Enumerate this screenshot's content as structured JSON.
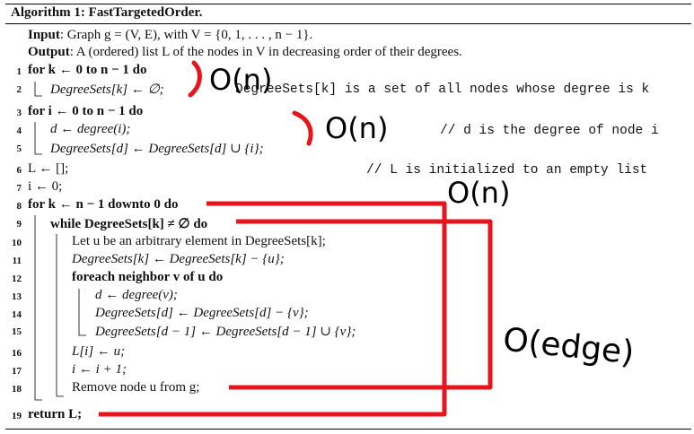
{
  "algorithm": {
    "title": "Algorithm 1: FastTargetedOrder.",
    "input_label": "Input",
    "input_text": ": Graph g = (V, E), with V = {0, 1, . . . , n − 1}.",
    "output_label": "Output",
    "output_text": ": A (ordered) list L of the nodes in V in decreasing order of their degrees.",
    "lines": [
      {
        "num": "1",
        "text": "for k ← 0 to n − 1 do"
      },
      {
        "num": "2",
        "text": "DegreeSets[k] ← ∅;"
      },
      {
        "num": "3",
        "text": "for i ← 0 to n − 1 do"
      },
      {
        "num": "4",
        "text": "d ← degree(i);"
      },
      {
        "num": "5",
        "text": "DegreeSets[d] ← DegreeSets[d] ∪ {i};"
      },
      {
        "num": "6",
        "text": "L ← [];"
      },
      {
        "num": "7",
        "text": "i ← 0;"
      },
      {
        "num": "8",
        "text": "for k ← n − 1 downto 0 do"
      },
      {
        "num": "9",
        "text": "while DegreeSets[k] ≠ ∅ do"
      },
      {
        "num": "10",
        "text": "Let u be an arbitrary element in DegreeSets[k];"
      },
      {
        "num": "11",
        "text": "DegreeSets[k] ← DegreeSets[k] − {u};"
      },
      {
        "num": "12",
        "text": "foreach neighbor v of u do"
      },
      {
        "num": "13",
        "text": "d ← degree(v);"
      },
      {
        "num": "14",
        "text": "DegreeSets[d] ← DegreeSets[d] − {v};"
      },
      {
        "num": "15",
        "text": "DegreeSets[d − 1] ← DegreeSets[d − 1] ∪ {v};"
      },
      {
        "num": "16",
        "text": "L[i] ← u;"
      },
      {
        "num": "17",
        "text": "i ← i + 1;"
      },
      {
        "num": "18",
        "text": "Remove node u from g;"
      },
      {
        "num": "19",
        "text": "return L;"
      }
    ],
    "comments": {
      "line2": "DegreeSets[k] is a set of all nodes whose degree is k",
      "line4": "// d is the degree of node i",
      "line6": "// L is initialized to an empty list"
    }
  },
  "annotations": {
    "ink_color": "#e8141b",
    "note1": "O(n)",
    "note2": "O(n)",
    "note3": "O(n)",
    "note4": "O(edge)"
  }
}
